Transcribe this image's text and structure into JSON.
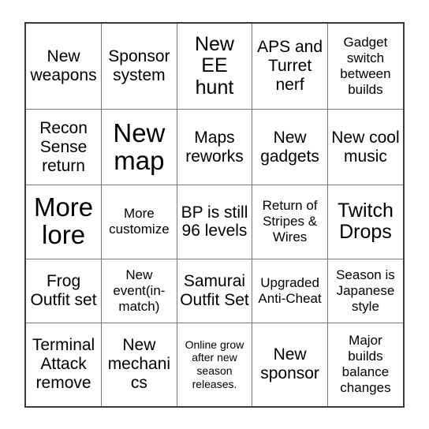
{
  "card": {
    "type": "bingo-card",
    "columns": 5,
    "rows": 5,
    "border_color": "#3a3a3a",
    "grid_line_color": "#787878",
    "background_color": "#ffffff",
    "text_color": "#000000",
    "cells": [
      {
        "text": "New weapons",
        "size": "md"
      },
      {
        "text": "Sponsor system",
        "size": "md"
      },
      {
        "text": "New EE hunt",
        "size": "lg"
      },
      {
        "text": "APS and Turret nerf",
        "size": "md"
      },
      {
        "text": "Gadget switch between builds",
        "size": "sm"
      },
      {
        "text": "Recon Sense return",
        "size": "md"
      },
      {
        "text": "New map",
        "size": "xl"
      },
      {
        "text": "Maps reworks",
        "size": "md"
      },
      {
        "text": "New gadgets",
        "size": "md"
      },
      {
        "text": "New cool music",
        "size": "md"
      },
      {
        "text": "More lore",
        "size": "xl"
      },
      {
        "text": "More customize",
        "size": "sm"
      },
      {
        "text": "BP is still 96 levels",
        "size": "md"
      },
      {
        "text": "Return of Stripes & Wires",
        "size": "sm"
      },
      {
        "text": "Twitch Drops",
        "size": "lg"
      },
      {
        "text": "Frog Outfit set",
        "size": "md"
      },
      {
        "text": "New event(in-match)",
        "size": "sm"
      },
      {
        "text": "Samurai Outfit Set",
        "size": "md"
      },
      {
        "text": "Upgraded Anti-Cheat",
        "size": "sm"
      },
      {
        "text": "Season is Japanese style",
        "size": "sm"
      },
      {
        "text": "Terminal Attack remove",
        "size": "md"
      },
      {
        "text": "New mechanics",
        "size": "md"
      },
      {
        "text": "Online grow after new season releases.",
        "size": "xs"
      },
      {
        "text": "New sponsor",
        "size": "md"
      },
      {
        "text": "Major builds balance changes",
        "size": "sm"
      }
    ]
  }
}
